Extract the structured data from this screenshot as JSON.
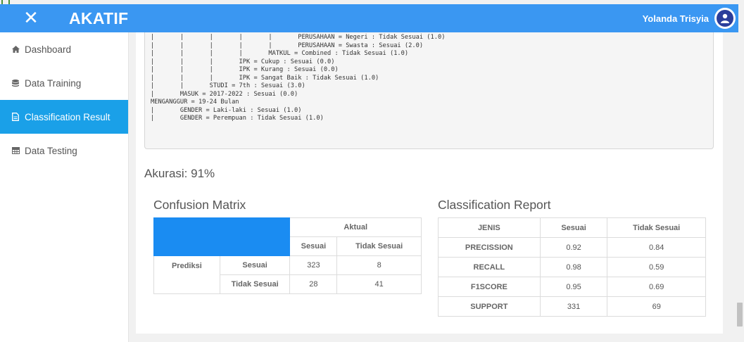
{
  "app": {
    "brand": "AKATIF",
    "user_name": "Yolanda Trisyia"
  },
  "sidebar": {
    "items": [
      {
        "label": "Dashboard",
        "icon": "home-icon"
      },
      {
        "label": "Data Training",
        "icon": "database-icon"
      },
      {
        "label": "Classification Result",
        "icon": "file-icon",
        "active": true
      },
      {
        "label": "Data Testing",
        "icon": "table-icon"
      }
    ]
  },
  "tree": {
    "lines": [
      "|       |       |       |       |       PERUSAHAAN = Negeri : Tidak Sesuai (1.0)",
      "|       |       |       |       |       PERUSAHAAN = Swasta : Sesuai (2.0)",
      "|       |       |       |       MATKUL = Combined : Tidak Sesuai (1.0)",
      "|       |       |       IPK = Cukup : Sesuai (0.0)",
      "|       |       |       IPK = Kurang : Sesuai (0.0)",
      "|       |       |       IPK = Sangat Baik : Tidak Sesuai (1.0)",
      "|       |       STUDI = 7th : Sesuai (3.0)",
      "|       MASUK = 2017-2022 : Sesuai (0.0)",
      "MENGANGGUR = 19-24 Bulan",
      "|       GENDER = Laki-laki : Sesuai (1.0)",
      "|       GENDER = Perempuan : Tidak Sesuai (1.0)"
    ]
  },
  "accuracy": "Akurasi: 91%",
  "confusion_matrix": {
    "title": "Confusion Matrix",
    "actual_label": "Aktual",
    "predicted_label": "Prediksi",
    "col_headers": [
      "Sesuai",
      "Tidak Sesuai"
    ],
    "rows": [
      {
        "label": "Sesuai",
        "values": [
          "323",
          "8"
        ]
      },
      {
        "label": "Tidak Sesuai",
        "values": [
          "28",
          "41"
        ]
      }
    ]
  },
  "classification_report": {
    "title": "Classification Report",
    "headers": [
      "JENIS",
      "Sesuai",
      "Tidak Sesuai"
    ],
    "rows": [
      [
        "PRECISSION",
        "0.92",
        "0.84"
      ],
      [
        "RECALL",
        "0.98",
        "0.59"
      ],
      [
        "F1SCORE",
        "0.95",
        "0.69"
      ],
      [
        "SUPPORT",
        "331",
        "69"
      ]
    ]
  }
}
